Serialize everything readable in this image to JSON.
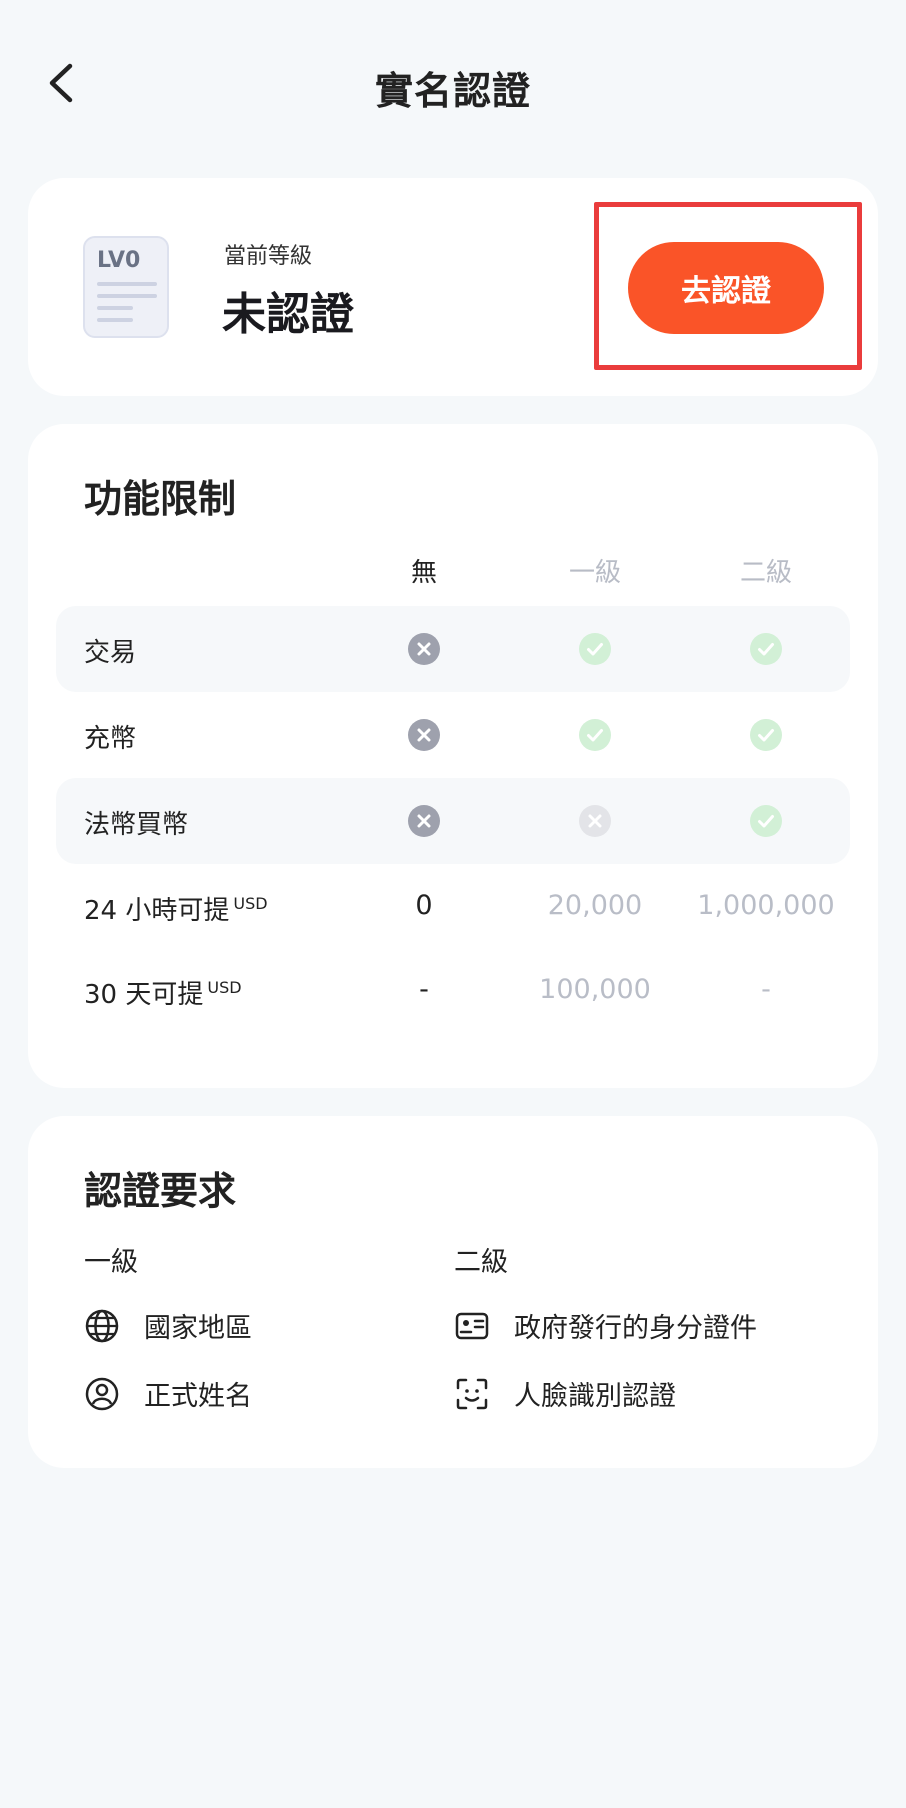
{
  "header": {
    "title": "實名認證"
  },
  "level_card": {
    "badge_text": "LV0",
    "caption": "當前等級",
    "level": "未認證",
    "button_label": "去認證",
    "accent_color": "#fa5428"
  },
  "limits": {
    "title": "功能限制",
    "columns": [
      "無",
      "一級",
      "二級"
    ],
    "rows": [
      {
        "label": "交易",
        "values": [
          "cross",
          "check",
          "check"
        ]
      },
      {
        "label": "充幣",
        "values": [
          "cross",
          "check",
          "check"
        ]
      },
      {
        "label": "法幣買幣",
        "values": [
          "cross",
          "cross",
          "check"
        ]
      },
      {
        "label": "24 小時可提",
        "unit": "USD",
        "values": [
          "0",
          "20,000",
          "1,000,000"
        ]
      },
      {
        "label": "30 天可提",
        "unit": "USD",
        "values": [
          "-",
          "100,000",
          "-"
        ]
      }
    ]
  },
  "requirements": {
    "title": "認證要求",
    "level1": {
      "label": "一級",
      "items": [
        {
          "icon": "globe-icon",
          "text": "國家地區"
        },
        {
          "icon": "user-circle-icon",
          "text": "正式姓名"
        }
      ]
    },
    "level2": {
      "label": "二級",
      "items": [
        {
          "icon": "id-card-icon",
          "text": "政府發行的身分證件"
        },
        {
          "icon": "face-scan-icon",
          "text": "人臉識別認證"
        }
      ]
    }
  }
}
